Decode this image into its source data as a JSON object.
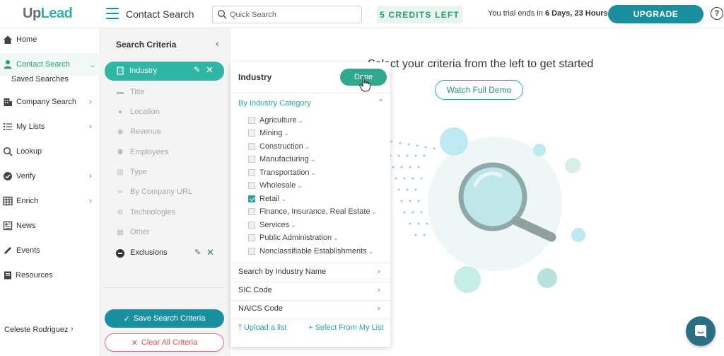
{
  "header": {
    "logo": {
      "up": "Up",
      "lead": "Lead"
    },
    "page_title": "Contact Search",
    "search_placeholder": "Quick Search",
    "credits": "5 CREDITS LEFT",
    "trial_prefix": "You trial ends in ",
    "trial_bold": "6 Days, 23 Hours",
    "upgrade": "UPGRADE",
    "help": "?"
  },
  "nav": {
    "items": [
      {
        "label": "Home",
        "icon": "home-icon"
      },
      {
        "label": "Contact Search",
        "icon": "person-icon",
        "active": true
      },
      {
        "label": "Company Search",
        "icon": "building-icon"
      },
      {
        "label": "My Lists",
        "icon": "list-icon"
      },
      {
        "label": "Lookup",
        "icon": "search-icon"
      },
      {
        "label": "Verify",
        "icon": "check-circle-icon"
      },
      {
        "label": "Enrich",
        "icon": "table-icon"
      },
      {
        "label": "News",
        "icon": "newspaper-icon"
      },
      {
        "label": "Events",
        "icon": "pen-icon"
      },
      {
        "label": "Resources",
        "icon": "book-icon"
      }
    ],
    "saved_searches": "Saved Searches",
    "user": "Celeste Rodriguez"
  },
  "criteria": {
    "title": "Search Criteria",
    "active": "Industry",
    "items": [
      "Title",
      "Location",
      "Revenue",
      "Employees",
      "Type",
      "By Company URL",
      "Technologies",
      "Other"
    ],
    "exclusions": "Exclusions",
    "save": "Save Search Criteria",
    "clear": "Clear All Criteria"
  },
  "dropdown": {
    "title": "Industry",
    "done": "Done",
    "category": "By Industry Category",
    "options": [
      {
        "label": "Agriculture",
        "checked": false
      },
      {
        "label": "Mining",
        "checked": false
      },
      {
        "label": "Construction",
        "checked": false
      },
      {
        "label": "Manufacturing",
        "checked": false
      },
      {
        "label": "Transportation",
        "checked": false
      },
      {
        "label": "Wholesale",
        "checked": false
      },
      {
        "label": "Retail",
        "checked": true
      },
      {
        "label": "Finance, Insurance, Real Estate",
        "checked": false
      },
      {
        "label": "Services",
        "checked": false
      },
      {
        "label": "Public Administration",
        "checked": false
      },
      {
        "label": "Nonclassifiable Establishments",
        "checked": false
      }
    ],
    "links": [
      "Search by Industry Name",
      "SIC Code",
      "NAICS Code"
    ],
    "upload": "Upload a list",
    "select_list": "Select From My List"
  },
  "main": {
    "headline": "Select your criteria from the left to get started",
    "demo": "Watch Full Demo"
  },
  "colors": {
    "brand": "#1a8fa0",
    "accent": "#2fb6a4",
    "danger": "#d9534f"
  }
}
